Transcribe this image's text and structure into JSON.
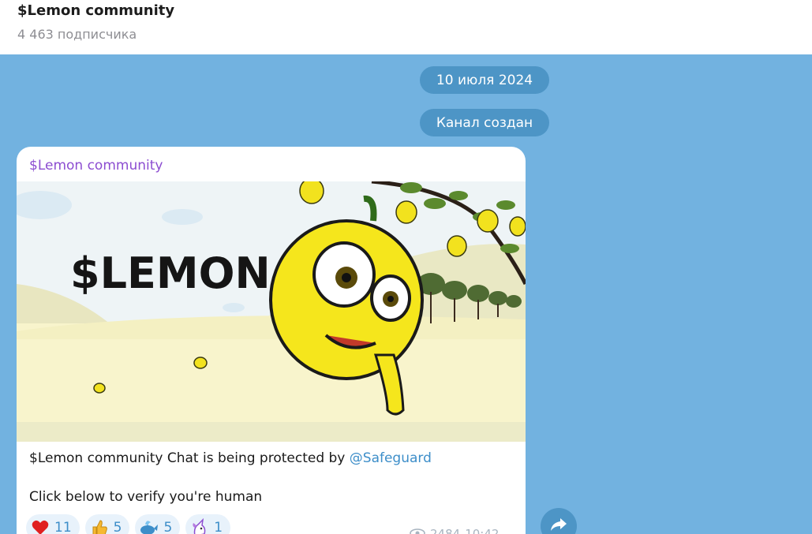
{
  "header": {
    "title": "$Lemon community",
    "subtitle": "4 463 подписчика"
  },
  "service": {
    "date": "10 июля 2024",
    "created": "Канал создан"
  },
  "post": {
    "author": "$Lemon community",
    "image_logo_text": "$LEMON",
    "text_line1_prefix": "$Lemon community Chat is being protected by ",
    "text_line1_link": "@Safeguard",
    "text_line2": "Click below to verify you're human",
    "views": "2484",
    "time": "10:42",
    "reactions": [
      {
        "emoji": "heart-icon",
        "count": "11"
      },
      {
        "emoji": "thumbs-up-icon",
        "count": "5"
      },
      {
        "emoji": "whale-icon",
        "count": "5"
      },
      {
        "emoji": "unicorn-icon",
        "count": "1"
      }
    ]
  },
  "colors": {
    "background": "#72b2e0",
    "pill": "#4d95c6",
    "author": "#8c4dd1",
    "link": "#3d8ec9"
  }
}
